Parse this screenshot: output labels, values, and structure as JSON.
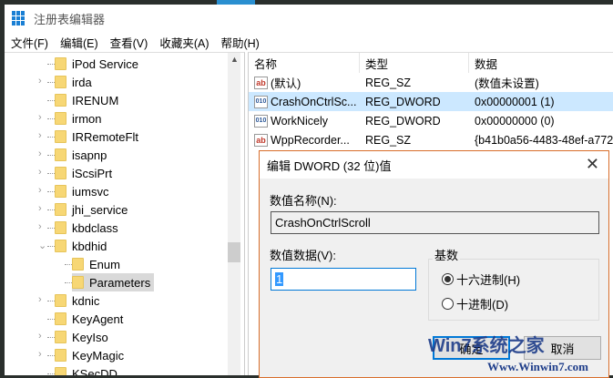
{
  "window": {
    "title": "注册表编辑器"
  },
  "menu": [
    "文件(F)",
    "编辑(E)",
    "查看(V)",
    "收藏夹(A)",
    "帮助(H)"
  ],
  "tree": [
    {
      "label": "iPod Service",
      "expander": "none",
      "depth": 0
    },
    {
      "label": "irda",
      "expander": "collapsed",
      "depth": 0
    },
    {
      "label": "IRENUM",
      "expander": "none",
      "depth": 0
    },
    {
      "label": "irmon",
      "expander": "collapsed",
      "depth": 0
    },
    {
      "label": "IRRemoteFlt",
      "expander": "collapsed",
      "depth": 0
    },
    {
      "label": "isapnp",
      "expander": "collapsed",
      "depth": 0
    },
    {
      "label": "iScsiPrt",
      "expander": "collapsed",
      "depth": 0
    },
    {
      "label": "iumsvc",
      "expander": "collapsed",
      "depth": 0
    },
    {
      "label": "jhi_service",
      "expander": "collapsed",
      "depth": 0
    },
    {
      "label": "kbdclass",
      "expander": "collapsed",
      "depth": 0
    },
    {
      "label": "kbdhid",
      "expander": "expanded",
      "depth": 0
    },
    {
      "label": "Enum",
      "expander": "none",
      "depth": 1
    },
    {
      "label": "Parameters",
      "expander": "none",
      "depth": 1,
      "selected": true
    },
    {
      "label": "kdnic",
      "expander": "collapsed",
      "depth": 0
    },
    {
      "label": "KeyAgent",
      "expander": "none",
      "depth": 0
    },
    {
      "label": "KeyIso",
      "expander": "collapsed",
      "depth": 0
    },
    {
      "label": "KeyMagic",
      "expander": "collapsed",
      "depth": 0
    },
    {
      "label": "KSecDD",
      "expander": "none",
      "depth": 0
    }
  ],
  "list": {
    "columns": [
      "名称",
      "类型",
      "数据"
    ],
    "rows": [
      {
        "name": "(默认)",
        "type": "REG_SZ",
        "data": "(数值未设置)",
        "icon": "ab"
      },
      {
        "name": "CrashOnCtrlSc...",
        "type": "REG_DWORD",
        "data": "0x00000001 (1)",
        "icon": "dword",
        "selected": true
      },
      {
        "name": "WorkNicely",
        "type": "REG_DWORD",
        "data": "0x00000000 (0)",
        "icon": "dword"
      },
      {
        "name": "WppRecorder...",
        "type": "REG_SZ",
        "data": "{b41b0a56-4483-48ef-a772",
        "icon": "ab"
      }
    ]
  },
  "dialog": {
    "title": "编辑 DWORD (32 位)值",
    "name_label": "数值名称(N):",
    "name_value": "CrashOnCtrlScroll",
    "data_label": "数值数据(V):",
    "data_value": "1",
    "base_label": "基数",
    "hex_label": "十六进制(H)",
    "dec_label": "十进制(D)",
    "selected_base": "hex",
    "ok_label": "确定",
    "cancel_label": "取消"
  },
  "watermark": {
    "text": "Win7系统之家",
    "url": "Www.Winwin7.com"
  }
}
